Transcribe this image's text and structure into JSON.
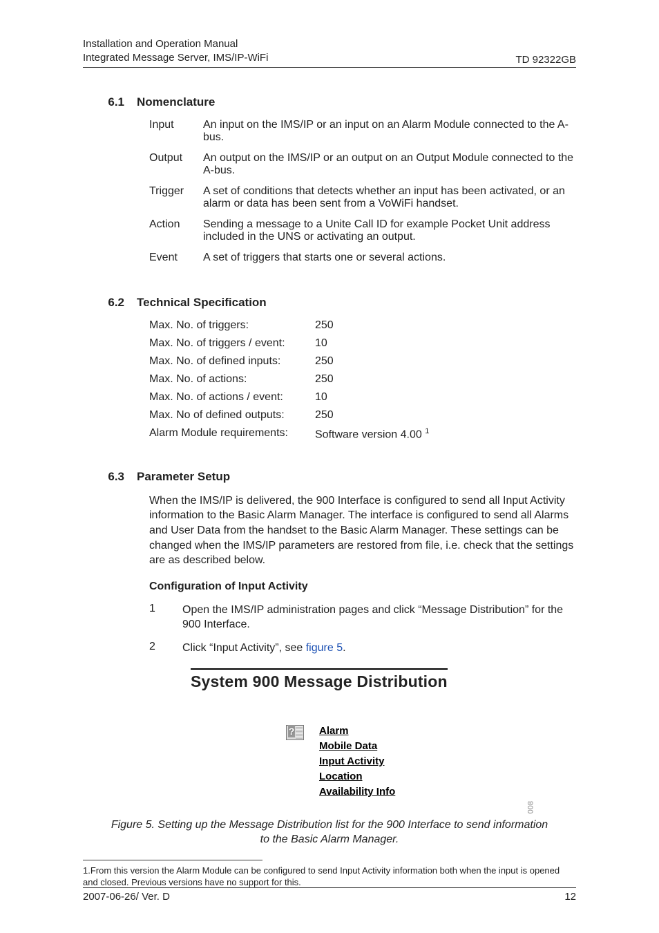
{
  "header": {
    "line1": "Installation and Operation Manual",
    "line2": "Integrated Message Server, IMS/IP-WiFi",
    "right": "TD 92322GB"
  },
  "s61": {
    "num": "6.1",
    "title": "Nomenclature",
    "defs": [
      {
        "term": "Input",
        "desc": "An input on the IMS/IP or an input on an Alarm Module connected to the A-bus."
      },
      {
        "term": "Output",
        "desc": "An output on the IMS/IP or an output on an Output Module connected to the A-bus."
      },
      {
        "term": "Trigger",
        "desc": "A set of conditions that detects whether an input has been activated, or an alarm or data has been sent from a VoWiFi handset."
      },
      {
        "term": "Action",
        "desc": "Sending a message to a Unite Call ID for example Pocket Unit address included in the UNS or activating an output."
      },
      {
        "term": "Event",
        "desc": "A set of triggers that starts one or several actions."
      }
    ]
  },
  "s62": {
    "num": "6.2",
    "title": "Technical Specification",
    "rows": [
      {
        "label": "Max. No. of triggers:",
        "value": "250"
      },
      {
        "label": "Max. No. of triggers / event:",
        "value": "10"
      },
      {
        "label": "Max. No. of defined inputs:",
        "value": "250"
      },
      {
        "label": "Max. No. of actions:",
        "value": "250"
      },
      {
        "label": "Max. No. of actions / event:",
        "value": "10"
      },
      {
        "label": "Max. No of defined outputs:",
        "value": "250"
      }
    ],
    "alarm_label": "Alarm Module requirements:",
    "alarm_value_prefix": "Software version 4.00 ",
    "alarm_value_sup": "1"
  },
  "s63": {
    "num": "6.3",
    "title": "Parameter Setup",
    "para": "When the IMS/IP is delivered, the 900 Interface is configured to send all Input Activity information to the Basic Alarm Manager. The interface is configured to send all Alarms and User Data from the handset to the Basic Alarm Manager. These settings can be changed when the IMS/IP parameters are restored from file, i.e. check that the settings are as described below.",
    "subhead": "Configuration of Input Activity",
    "steps": [
      {
        "n": "1",
        "text": "Open the IMS/IP administration pages and click “Message Distribution” for the 900 Interface."
      }
    ],
    "step2": {
      "n": "2",
      "pre": "Click “Input Activity”, see ",
      "link": "figure 5",
      "post": "."
    }
  },
  "figure": {
    "title": "System 900 Message Distribution",
    "links": [
      "Alarm",
      "Mobile Data",
      "Input Activity",
      "Location",
      "Availability Info"
    ],
    "marker": "008",
    "caption": "Figure 5. Setting up the Message Distribution list for the 900 Interface to send information to the Basic Alarm Manager."
  },
  "footnote": {
    "text": "1.From this version the Alarm Module can be configured to send Input Activity information both when the input is opened and closed. Previous versions have no support for this."
  },
  "footer": {
    "left": "2007-06-26/ Ver. D",
    "right": "12"
  }
}
